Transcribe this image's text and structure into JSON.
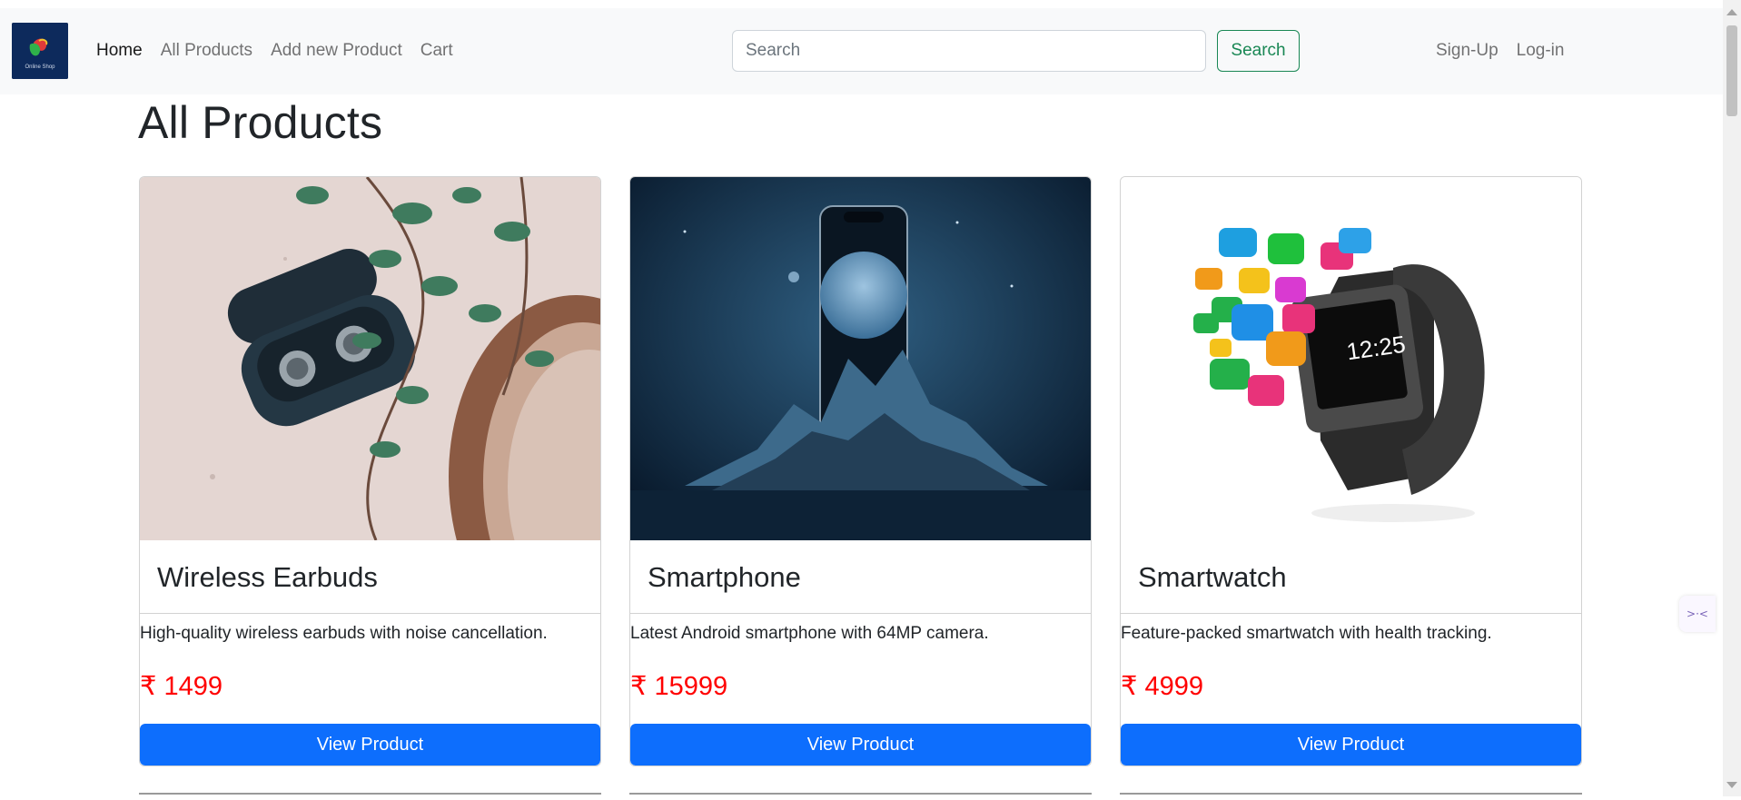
{
  "nav": {
    "logo_text": "Online Shop",
    "links": [
      "Home",
      "All Products",
      "Add new Product",
      "Cart"
    ],
    "search_placeholder": "Search",
    "search_button": "Search",
    "auth_links": [
      "Sign-Up",
      "Log-in"
    ]
  },
  "page": {
    "title": "All Products"
  },
  "products": [
    {
      "name": "Wireless Earbuds",
      "description": "High-quality wireless earbuds with noise cancellation.",
      "price": "₹ 1499",
      "button": "View Product"
    },
    {
      "name": "Smartphone",
      "description": "Latest Android smartphone with 64MP camera.",
      "price": "₹ 15999",
      "button": "View Product"
    },
    {
      "name": "Smartwatch",
      "description": "Feature-packed smartwatch with health tracking.",
      "price": "₹ 4999",
      "button": "View Product"
    }
  ],
  "watch_time": "12:25",
  "colors": {
    "primary": "#0d6efd",
    "success": "#198754",
    "price": "#ff0000",
    "navbar_bg": "#f8f9fa",
    "logo_bg": "#0d2a5c"
  }
}
